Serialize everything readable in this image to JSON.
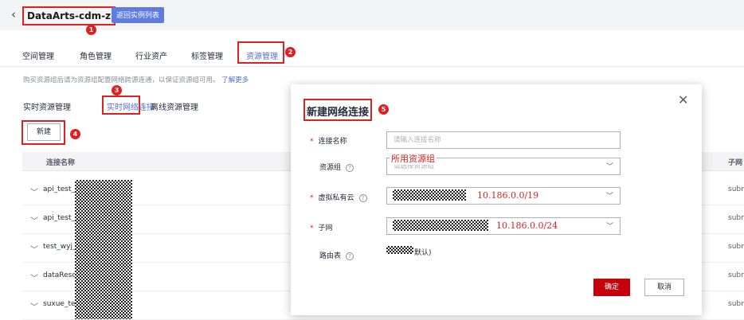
{
  "header": {
    "back_icon": "chevron-left-icon",
    "title": "DataArts-cdm-z",
    "return_label": "返回实例列表"
  },
  "tabs": [
    {
      "label": "空间管理"
    },
    {
      "label": "角色管理"
    },
    {
      "label": "行业资产"
    },
    {
      "label": "标签管理"
    },
    {
      "label": "资源管理",
      "active": true
    }
  ],
  "hint": {
    "text": "购买资源组后请为资源组配置网络跨源连通，以保证资源组可用。",
    "link": "了解更多"
  },
  "subtabs": [
    {
      "label": "实时资源管理"
    },
    {
      "label": "实时网络连接",
      "active": true
    },
    {
      "label": "离线资源管理"
    }
  ],
  "new_button": "新建",
  "table": {
    "columns": [
      "连接名称",
      "子网"
    ],
    "rows": [
      {
        "name": "api_test_",
        "subnet": "subn"
      },
      {
        "name": "api_test_",
        "subnet": "subn"
      },
      {
        "name": "test_wyj_",
        "subnet": "subn"
      },
      {
        "name": "dataReso",
        "subnet": "subn"
      },
      {
        "name": "suxue_te",
        "subnet": "subn"
      }
    ]
  },
  "badges": [
    "1",
    "2",
    "3",
    "4",
    "5"
  ],
  "dialog": {
    "title": "新建网络连接",
    "close_icon": "close-icon",
    "fields": {
      "name": {
        "label": "连接名称",
        "placeholder": "请输入连接名称",
        "required": true
      },
      "resource_group": {
        "label": "资源组",
        "placeholder": "请选择资源组",
        "annotation": "所用资源组"
      },
      "vpc": {
        "label": "虚拟私有云",
        "required": true,
        "annotation": "10.186.0.0/19"
      },
      "subnet": {
        "label": "子网",
        "required": true,
        "annotation": "10.186.0.0/24"
      },
      "route_table": {
        "label": "路由表",
        "value": "默认)"
      }
    },
    "required_mark": "*",
    "help_icon": "?",
    "ok_label": "确定",
    "cancel_label": "取消"
  },
  "colors": {
    "accent": "#526ecc",
    "primary_button": "#c7000b",
    "annotation_red": "#e02020",
    "header_btn": "#5e7ce0"
  }
}
